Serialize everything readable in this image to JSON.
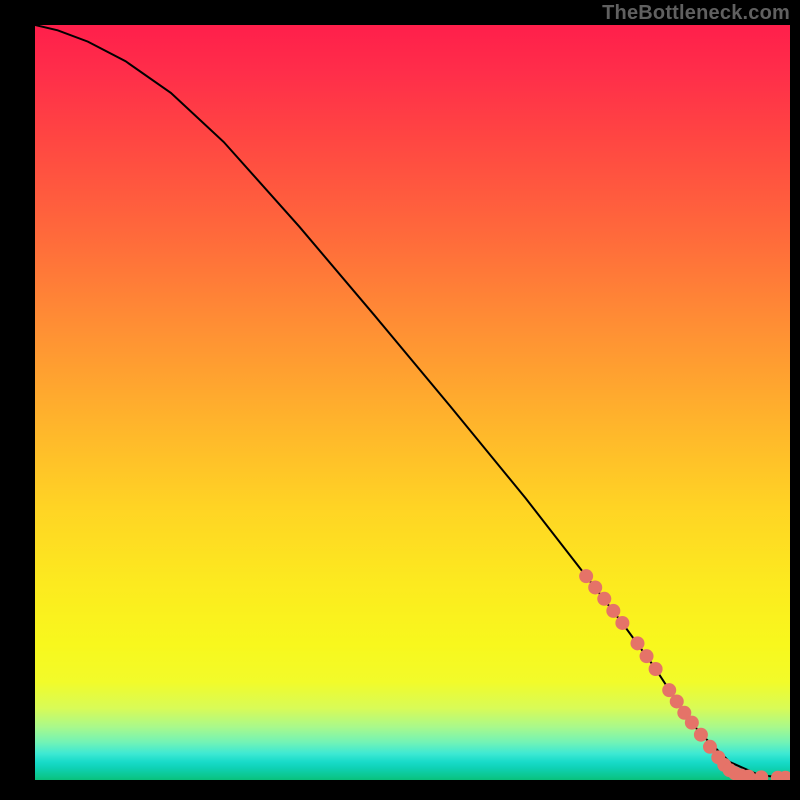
{
  "watermark": "TheBottleneck.com",
  "chart_data": {
    "type": "line",
    "title": "",
    "xlabel": "",
    "ylabel": "",
    "xlim": [
      0,
      100
    ],
    "ylim": [
      0,
      100
    ],
    "grid": false,
    "series": [
      {
        "name": "curve",
        "color": "#000000",
        "x": [
          0,
          3,
          7,
          12,
          18,
          25,
          35,
          45,
          55,
          65,
          73,
          78,
          82,
          85,
          88,
          92,
          96,
          100
        ],
        "y": [
          100,
          99.3,
          97.8,
          95.2,
          91,
          84.5,
          73.3,
          61.5,
          49.5,
          37.3,
          27.0,
          20.5,
          15.0,
          10.4,
          6.3,
          2.4,
          0.6,
          0.3
        ]
      }
    ],
    "markers": {
      "name": "dots",
      "color": "#e57368",
      "radius_px": 7,
      "points": [
        {
          "x": 73.0,
          "y": 27.0
        },
        {
          "x": 74.2,
          "y": 25.5
        },
        {
          "x": 75.4,
          "y": 24.0
        },
        {
          "x": 76.6,
          "y": 22.4
        },
        {
          "x": 77.8,
          "y": 20.8
        },
        {
          "x": 79.8,
          "y": 18.1
        },
        {
          "x": 81.0,
          "y": 16.4
        },
        {
          "x": 82.2,
          "y": 14.7
        },
        {
          "x": 84.0,
          "y": 11.9
        },
        {
          "x": 85.0,
          "y": 10.4
        },
        {
          "x": 86.0,
          "y": 8.9
        },
        {
          "x": 87.0,
          "y": 7.6
        },
        {
          "x": 88.2,
          "y": 6.0
        },
        {
          "x": 89.4,
          "y": 4.4
        },
        {
          "x": 90.5,
          "y": 3.0
        },
        {
          "x": 91.3,
          "y": 2.0
        },
        {
          "x": 92.0,
          "y": 1.3
        },
        {
          "x": 92.7,
          "y": 0.9
        },
        {
          "x": 93.5,
          "y": 0.6
        },
        {
          "x": 94.5,
          "y": 0.45
        },
        {
          "x": 96.2,
          "y": 0.35
        },
        {
          "x": 98.4,
          "y": 0.3
        },
        {
          "x": 99.4,
          "y": 0.3
        }
      ]
    },
    "gradient_stops": [
      {
        "pos": 0.0,
        "color": "#ff1f4b"
      },
      {
        "pos": 0.06,
        "color": "#ff2d4a"
      },
      {
        "pos": 0.14,
        "color": "#ff4343"
      },
      {
        "pos": 0.28,
        "color": "#ff6a3b"
      },
      {
        "pos": 0.4,
        "color": "#ff8f34"
      },
      {
        "pos": 0.52,
        "color": "#ffb22c"
      },
      {
        "pos": 0.64,
        "color": "#ffd424"
      },
      {
        "pos": 0.74,
        "color": "#fcea1f"
      },
      {
        "pos": 0.82,
        "color": "#f8f81d"
      },
      {
        "pos": 0.87,
        "color": "#f2fb2a"
      },
      {
        "pos": 0.905,
        "color": "#d8fb57"
      },
      {
        "pos": 0.93,
        "color": "#a8f98c"
      },
      {
        "pos": 0.95,
        "color": "#72f3b6"
      },
      {
        "pos": 0.965,
        "color": "#3ee9d3"
      },
      {
        "pos": 0.976,
        "color": "#18dbc9"
      },
      {
        "pos": 0.984,
        "color": "#0fd2b6"
      },
      {
        "pos": 0.99,
        "color": "#0dcc9f"
      },
      {
        "pos": 0.996,
        "color": "#0cc68b"
      },
      {
        "pos": 1.0,
        "color": "#09c07a"
      }
    ]
  }
}
